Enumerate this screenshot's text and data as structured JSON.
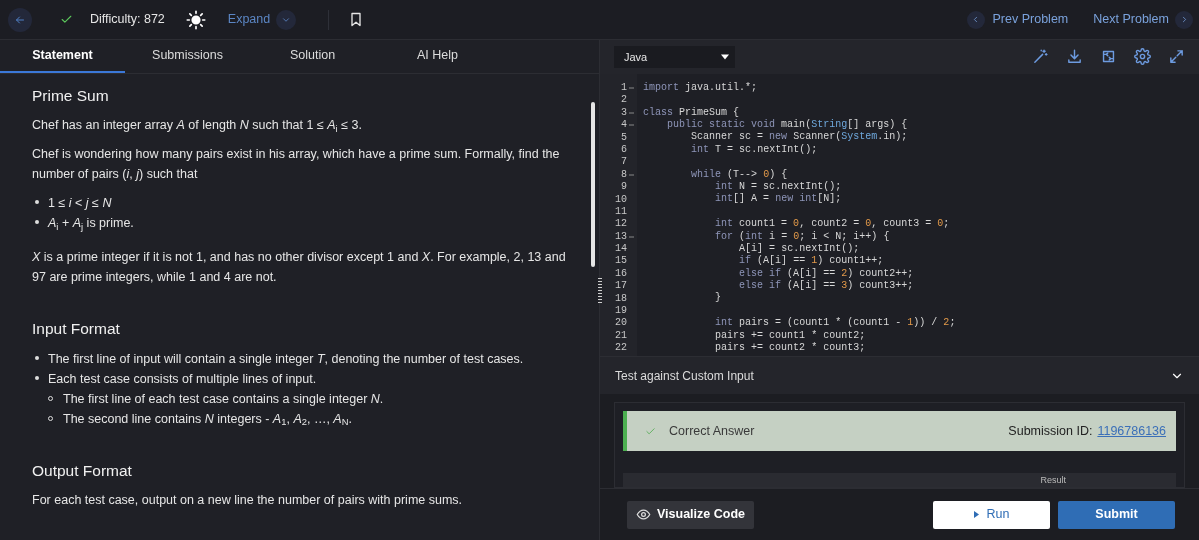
{
  "top_bar": {
    "solved": true,
    "difficulty": "Difficulty: 872",
    "expand": "Expand",
    "prev": "Prev Problem",
    "next": "Next Problem"
  },
  "tabs": [
    {
      "label": "Statement",
      "selected": true
    },
    {
      "label": "Submissions",
      "selected": false
    },
    {
      "label": "Solution",
      "selected": false
    },
    {
      "label": "AI Help",
      "selected": false
    }
  ],
  "statement": [
    {
      "heading": "Prime Sum",
      "blocks": [
        {
          "kind": "paragraph",
          "text": "Chef has an integer array *A* of length *N* such that 1 ≤ *A*$_{i}$ ≤ 3."
        },
        {
          "kind": "paragraph",
          "text": "Chef is wondering how many pairs exist in his array, which have a prime sum. Formally, find the number of pairs (*i*, *j*) such that"
        },
        {
          "kind": "list",
          "items": [
            {
              "text": "1 ≤ *i* < *j* ≤ *N*"
            },
            {
              "text": "*A*$_{i}$ + *A*$_{j}$ is prime."
            }
          ]
        },
        {
          "kind": "paragraph",
          "text": "*X* is a prime integer if it is not 1, and has no other divisor except 1 and *X*. For example, 2, 13 and 97 are prime integers, while 1 and 4 are not."
        }
      ]
    },
    {
      "heading": "Input Format",
      "blocks": [
        {
          "kind": "list",
          "items": [
            {
              "text": "The first line of input will contain a single integer *T*, denoting the number of test cases."
            },
            {
              "text": "Each test case consists of multiple lines of input.",
              "children": [
                {
                  "text": "The first line of each test case contains a single integer *N*."
                },
                {
                  "text": "The second line contains *N* integers - *A*$_{1}$, *A*$_{2}$, …, *A*$_{N}$."
                }
              ]
            }
          ]
        }
      ]
    },
    {
      "heading": "Output Format",
      "blocks": [
        {
          "kind": "paragraph",
          "text": "For each test case, output on a new line the number of pairs with prime sums."
        }
      ]
    }
  ],
  "editor": {
    "language": "Java",
    "lines": [
      {
        "number": "1",
        "code": "import java.util.*;",
        "foldable": true
      },
      {
        "number": "2",
        "foldable": false
      },
      {
        "number": "3",
        "code": "class PrimeSum {",
        "foldable": true
      },
      {
        "number": "4",
        "code": "    public static void main(String[] args) {",
        "foldable": true
      },
      {
        "number": "5",
        "code": "        Scanner sc = new Scanner(System.in);",
        "foldable": false
      },
      {
        "number": "6",
        "code": "        int T = sc.nextInt();",
        "foldable": false
      },
      {
        "number": "7",
        "foldable": false
      },
      {
        "number": "8",
        "code": "        while (T--> 0) {",
        "foldable": true
      },
      {
        "number": "9",
        "code": "            int N = sc.nextInt();",
        "foldable": false
      },
      {
        "number": "10",
        "code": "            int[] A = new int[N];",
        "foldable": false
      },
      {
        "number": "11",
        "foldable": false
      },
      {
        "number": "12",
        "code": "            int count1 = 0, count2 = 0, count3 = 0;",
        "foldable": false
      },
      {
        "number": "13",
        "code": "            for (int i = 0; i < N; i++) {",
        "foldable": true
      },
      {
        "number": "14",
        "code": "                A[i] = sc.nextInt();",
        "foldable": false
      },
      {
        "number": "15",
        "code": "                if (A[i] == 1) count1++;",
        "foldable": false
      },
      {
        "number": "16",
        "code": "                else if (A[i] == 2) count2++;",
        "foldable": false
      },
      {
        "number": "17",
        "code": "                else if (A[i] == 3) count3++;",
        "foldable": false
      },
      {
        "number": "18",
        "code": "            }",
        "foldable": false
      },
      {
        "number": "19",
        "foldable": false
      },
      {
        "number": "20",
        "code": "            int pairs = (count1 * (count1 - 1)) / 2;",
        "foldable": false
      },
      {
        "number": "21",
        "code": "            pairs += count1 * count2;",
        "foldable": false
      },
      {
        "number": "22",
        "code": "            pairs += count2 * count3;",
        "foldable": false
      }
    ]
  },
  "custom_input": {
    "label": "Test against Custom Input",
    "expanded": false
  },
  "result": {
    "status": "Correct Answer",
    "submission_label": "Submission ID:",
    "submission_id": "1196786136",
    "table_header": "Result"
  },
  "buttons": {
    "visualize": "Visualize Code",
    "run": "Run",
    "submit": "Submit"
  }
}
